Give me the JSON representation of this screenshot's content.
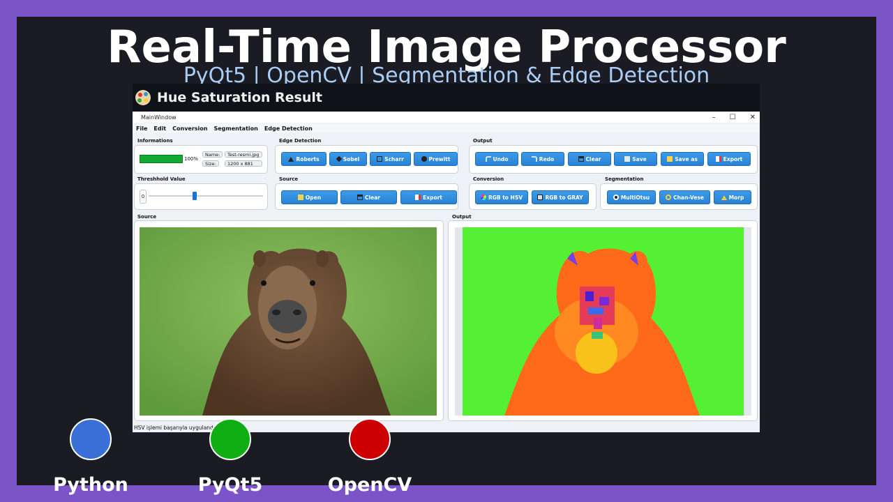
{
  "colors": {
    "frame": "#7b55c7",
    "background": "#1b1b24",
    "title": "#ffffff",
    "subtitle": "#a9cdf5",
    "button": "#2a82d6",
    "progress": "#12a832"
  },
  "banner": {
    "title": "Real-Time Image Processor",
    "subtitle": "PyQt5 | OpenCV | Segmentation & Edge Detection"
  },
  "screenshot": {
    "header_title": "Hue Saturation Result",
    "header_icon": "palette-icon",
    "window_title": "MainWindow",
    "window_controls": [
      "–",
      "☐",
      "✕"
    ],
    "menu": [
      "File",
      "Edit",
      "Conversion",
      "Segmentation",
      "Edge Detection"
    ],
    "informations": {
      "label": "Informations",
      "progress_value": 1.0,
      "progress_text": "100%",
      "name_label": "Name:",
      "name_value": "Test-resmi.jpg",
      "size_label": "Size:",
      "size_value": "1200 x 881"
    },
    "edge_detection": {
      "label": "Edge Detection",
      "buttons": [
        "Roberts",
        "Sobel",
        "Scharr",
        "Prewitt"
      ]
    },
    "output_group": {
      "label": "Output",
      "buttons": [
        "Undo",
        "Redo",
        "Clear",
        "Save",
        "Save as",
        "Export"
      ]
    },
    "threshold": {
      "label": "Threshhold Value",
      "value": "0",
      "slider_fraction": 0.4
    },
    "source_group": {
      "label": "Source",
      "buttons": [
        "Open",
        "Clear",
        "Export"
      ]
    },
    "conversion": {
      "label": "Conversion",
      "buttons": [
        "RGB to HSV",
        "RGB to GRAY"
      ]
    },
    "segmentation": {
      "label": "Segmentation",
      "buttons": [
        "MultiOtsu",
        "Chan-Vese",
        "Morp"
      ]
    },
    "source_view_label": "Source",
    "output_view_label": "Output",
    "status_text": "HSV işlemi başarıyla uygulandı"
  },
  "technologies": [
    {
      "name": "Python",
      "color": "#3a6fd8"
    },
    {
      "name": "PyQt5",
      "color": "#0fae14"
    },
    {
      "name": "OpenCV",
      "color": "#cc0000"
    }
  ]
}
